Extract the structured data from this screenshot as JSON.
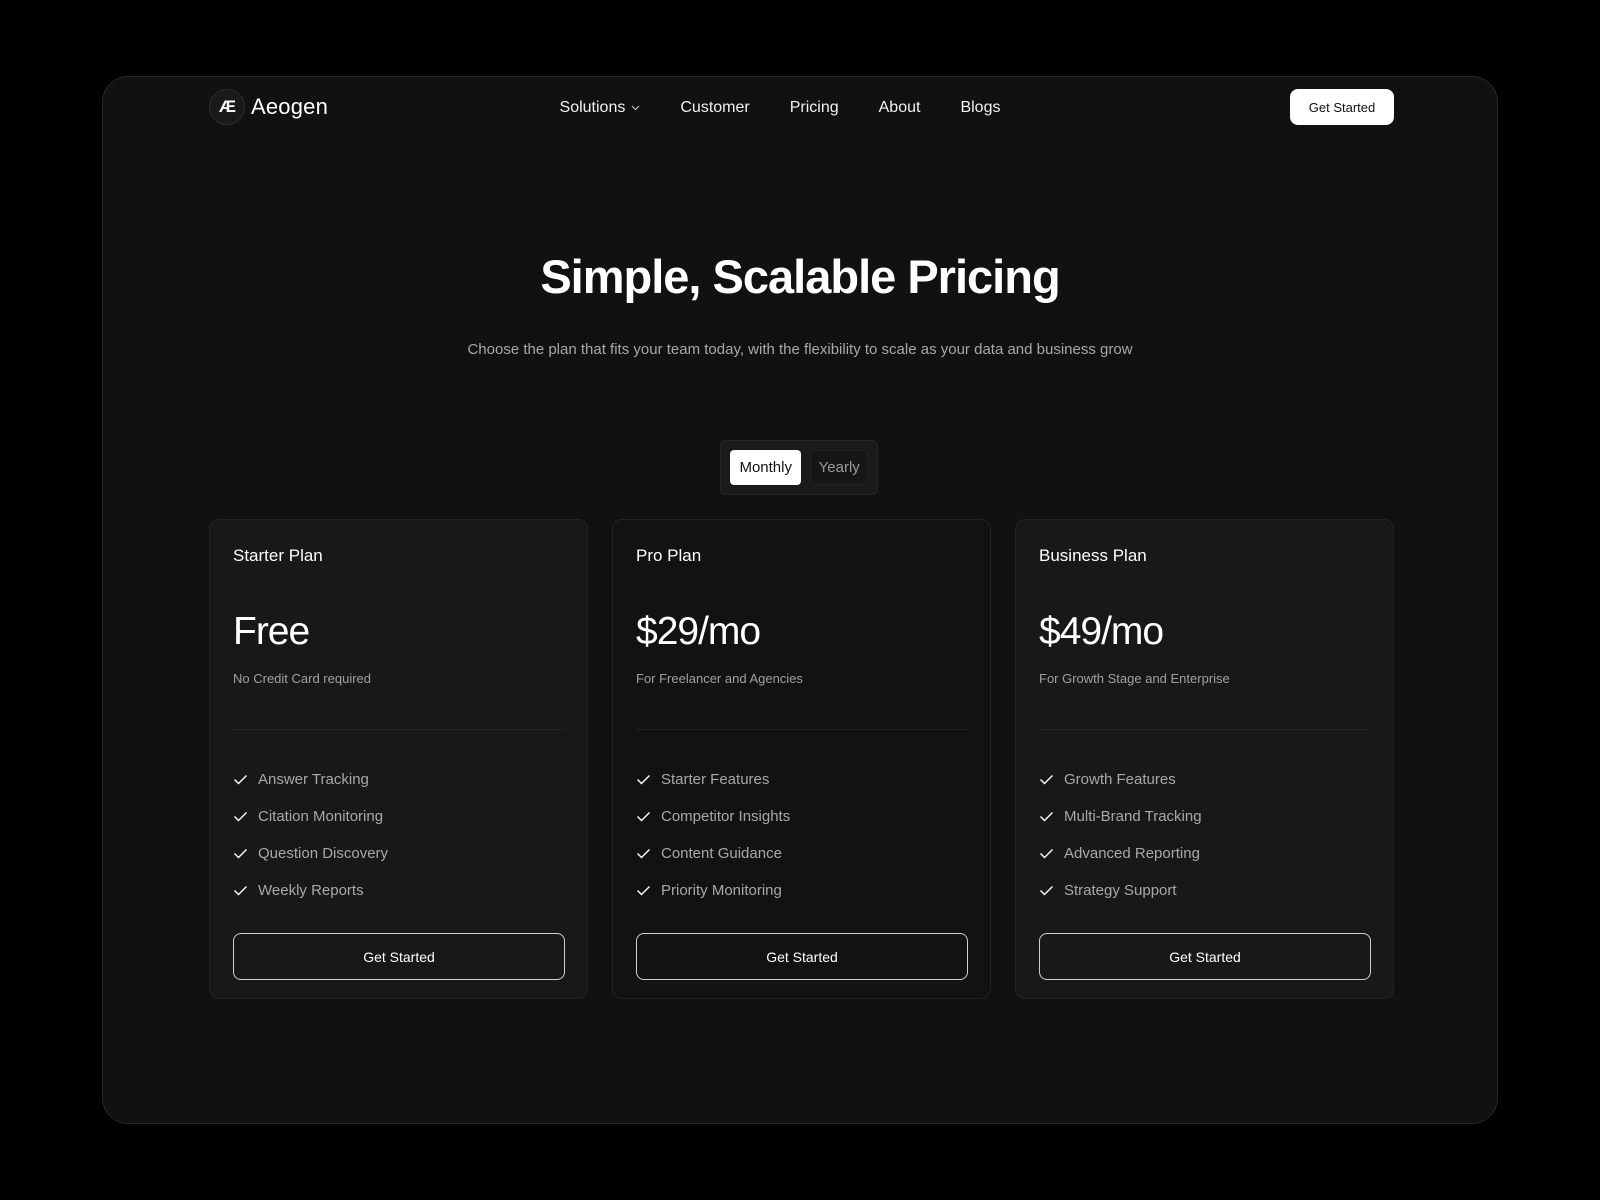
{
  "brand": {
    "logo_mark": "Æ",
    "name": "Aeogen"
  },
  "nav": {
    "items": [
      {
        "label": "Solutions",
        "has_dropdown": true
      },
      {
        "label": "Customer"
      },
      {
        "label": "Pricing"
      },
      {
        "label": "About"
      },
      {
        "label": "Blogs"
      }
    ],
    "dropdown_icon": "chevron-down-icon",
    "cta_label": "Get Started"
  },
  "hero": {
    "title": "Simple, Scalable Pricing",
    "subtitle": "Choose the plan that fits your team today, with the flexibility to scale as your data and business grow"
  },
  "billing_toggle": {
    "options": [
      "Monthly",
      "Yearly"
    ],
    "selected": "Monthly"
  },
  "plans": [
    {
      "name": "Starter Plan",
      "price": "Free",
      "description": "No Credit Card required",
      "features": [
        "Answer Tracking",
        "Citation Monitoring",
        "Question Discovery",
        "Weekly Reports"
      ],
      "cta_label": "Get Started"
    },
    {
      "name": "Pro Plan",
      "price": "$29/mo",
      "description": "For Freelancer and Agencies",
      "features": [
        "Starter Features",
        "Competitor Insights",
        "Content Guidance",
        "Priority Monitoring"
      ],
      "cta_label": "Get Started"
    },
    {
      "name": "Business Plan",
      "price": "$49/mo",
      "description": "For Growth Stage and Enterprise",
      "features": [
        "Growth Features",
        "Multi-Brand Tracking",
        "Advanced Reporting",
        "Strategy Support"
      ],
      "cta_label": "Get Started"
    }
  ],
  "feature_icon": "check-icon",
  "colors": {
    "page_background": "#000000",
    "frame_background": "#111111",
    "card_background": "#181818",
    "text_primary": "#ffffff",
    "text_muted": "#a8a8a8",
    "button_primary_bg": "#ffffff"
  }
}
